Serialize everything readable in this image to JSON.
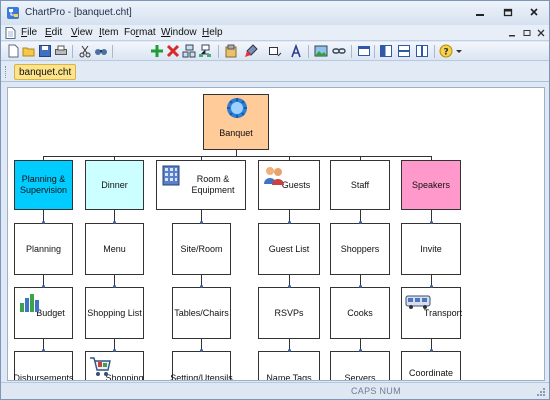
{
  "window": {
    "title": "ChartPro - [banquet.cht]"
  },
  "menu": {
    "items": [
      {
        "underline": "F",
        "rest": "ile"
      },
      {
        "underline": "E",
        "rest": "dit"
      },
      {
        "underline": "V",
        "rest": "iew"
      },
      {
        "underline": "I",
        "rest": "tem"
      },
      {
        "pre": "Fo",
        "underline": "r",
        "rest": "mat"
      },
      {
        "underline": "W",
        "rest": "indow"
      },
      {
        "underline": "H",
        "rest": "elp"
      }
    ]
  },
  "toolbar": {
    "icons": [
      "new-document-icon",
      "open-folder-icon",
      "save-icon",
      "print-icon",
      "cut-icon",
      "find-icon",
      "add-icon",
      "delete-icon",
      "insert-icon",
      "branch-icon",
      "paste-format-icon",
      "paint-brush-icon",
      "shape-icon",
      "font-icon",
      "picture-icon",
      "link-icon",
      "window-icon",
      "layout-icon",
      "split-h-icon",
      "split-v-icon",
      "help-icon"
    ]
  },
  "tabs": {
    "active": "banquet.cht"
  },
  "chart": {
    "root": "Banquet",
    "branches": [
      {
        "title": "Planning & Supervision",
        "fill": "#00ccff",
        "children": [
          "Planning",
          "Budget",
          "Disbursements"
        ]
      },
      {
        "title": "Dinner",
        "fill": "#ccffff",
        "children": [
          "Menu",
          "Shopping List",
          "Shopping"
        ]
      },
      {
        "title": "Room & Equipment",
        "fill": "#ffffff",
        "children": [
          "Site/Room",
          "Tables/Chairs",
          "Setting/Utensils"
        ]
      },
      {
        "title": "Guests",
        "fill": "#ffffff",
        "children": [
          "Guest List",
          "RSVPs",
          "Name Tags"
        ]
      },
      {
        "title": "Staff",
        "fill": "#ffffff",
        "children": [
          "Shoppers",
          "Cooks",
          "Servers"
        ]
      },
      {
        "title": "Speakers",
        "fill": "#ff99cc",
        "children": [
          "Invite",
          "Transport",
          "Coordinate"
        ]
      }
    ],
    "colors": {
      "root": "#ffcc99",
      "line": "#333333"
    }
  },
  "status": {
    "text": "CAPS  NUM"
  }
}
